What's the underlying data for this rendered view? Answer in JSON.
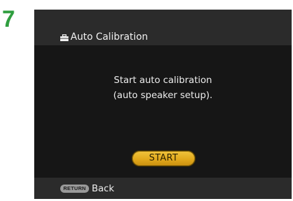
{
  "step_number": "7",
  "header": {
    "icon": "toolbox-icon",
    "title": "Auto Calibration"
  },
  "message": {
    "line1": "Start auto calibration",
    "line2": "(auto speaker setup)."
  },
  "start_button": {
    "label": "START",
    "color": "#e2a91c"
  },
  "footer": {
    "return_key_label": "RETURN",
    "back_label": "Back"
  },
  "colors": {
    "step_number": "#2f9e3f",
    "panel": "#2b2b2b",
    "content": "#161616"
  }
}
